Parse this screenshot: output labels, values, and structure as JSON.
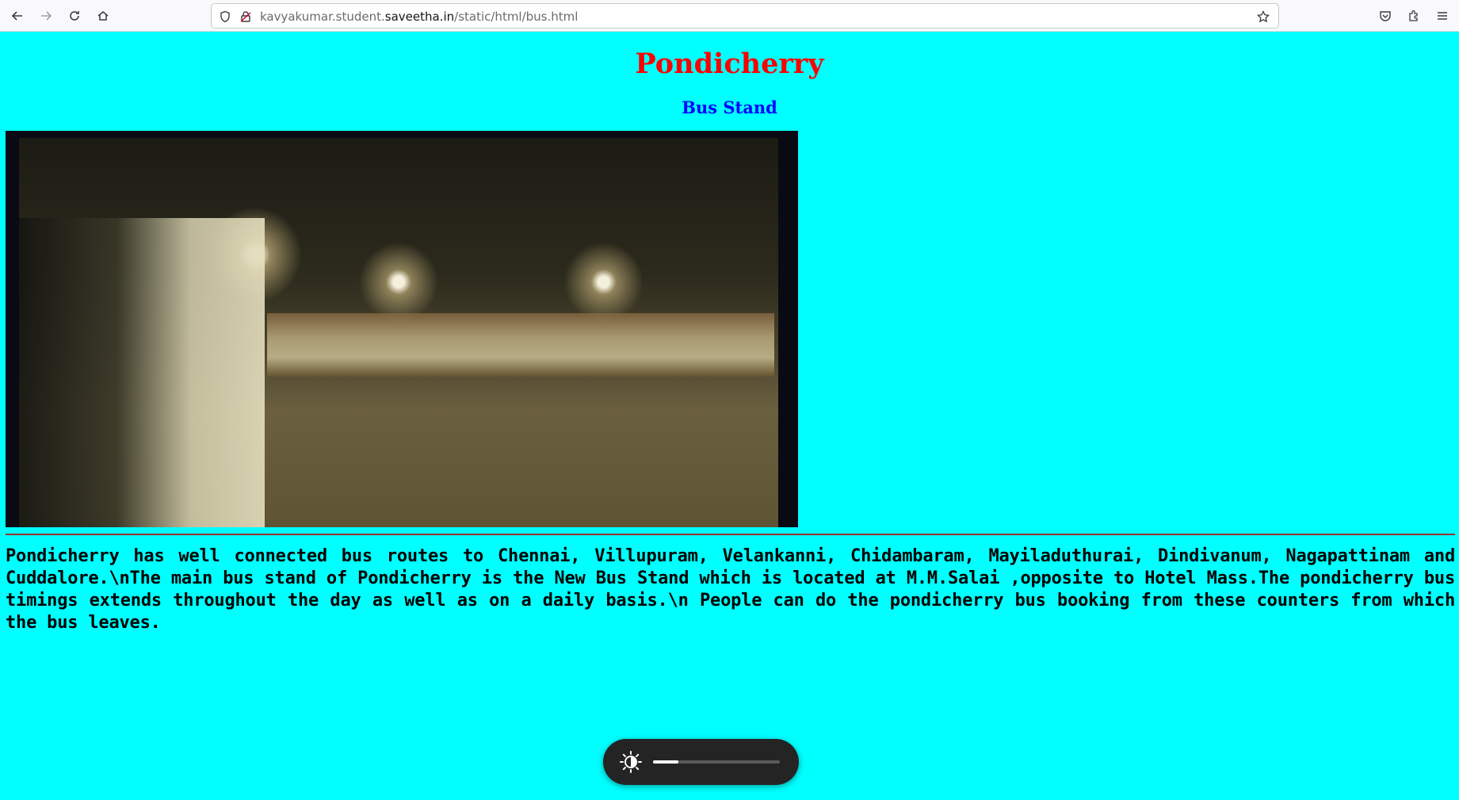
{
  "browser": {
    "url_prefix": "kavyakumar.student.",
    "url_domain": "saveetha.in",
    "url_path": "/static/html/bus.html",
    "icons": {
      "back": "back-arrow-icon",
      "forward": "forward-arrow-icon",
      "reload": "reload-icon",
      "home": "home-icon",
      "shield": "tracking-shield-icon",
      "lock": "lock-icon",
      "bookmark": "bookmark-star-icon",
      "pocket": "pocket-icon",
      "extensions": "extensions-icon",
      "menu": "hamburger-menu-icon"
    }
  },
  "page": {
    "title": "Pondicherry",
    "subtitle": "Bus Stand",
    "image_alt": "Pondicherry bus stand at night",
    "paragraph": "Pondicherry has well connected bus routes to Chennai, Villupuram, Velankanni, Chidambaram, Mayiladuthurai, Dindivanum, Nagapattinam and Cuddalore.\\nThe main bus stand of Pondicherry is the New Bus Stand which is located at M.M.Salai ,opposite to Hotel Mass.The pondicherry bus timings extends throughout the day as well as on a daily basis.\\n People can do the pondicherry bus booking from these counters from which the bus leaves.",
    "colors": {
      "background": "#00ffff",
      "title": "#ff0000",
      "subtitle": "#0000ff",
      "rule": "#a03030"
    }
  },
  "osd": {
    "icon": "brightness-icon",
    "level": 0.2
  }
}
